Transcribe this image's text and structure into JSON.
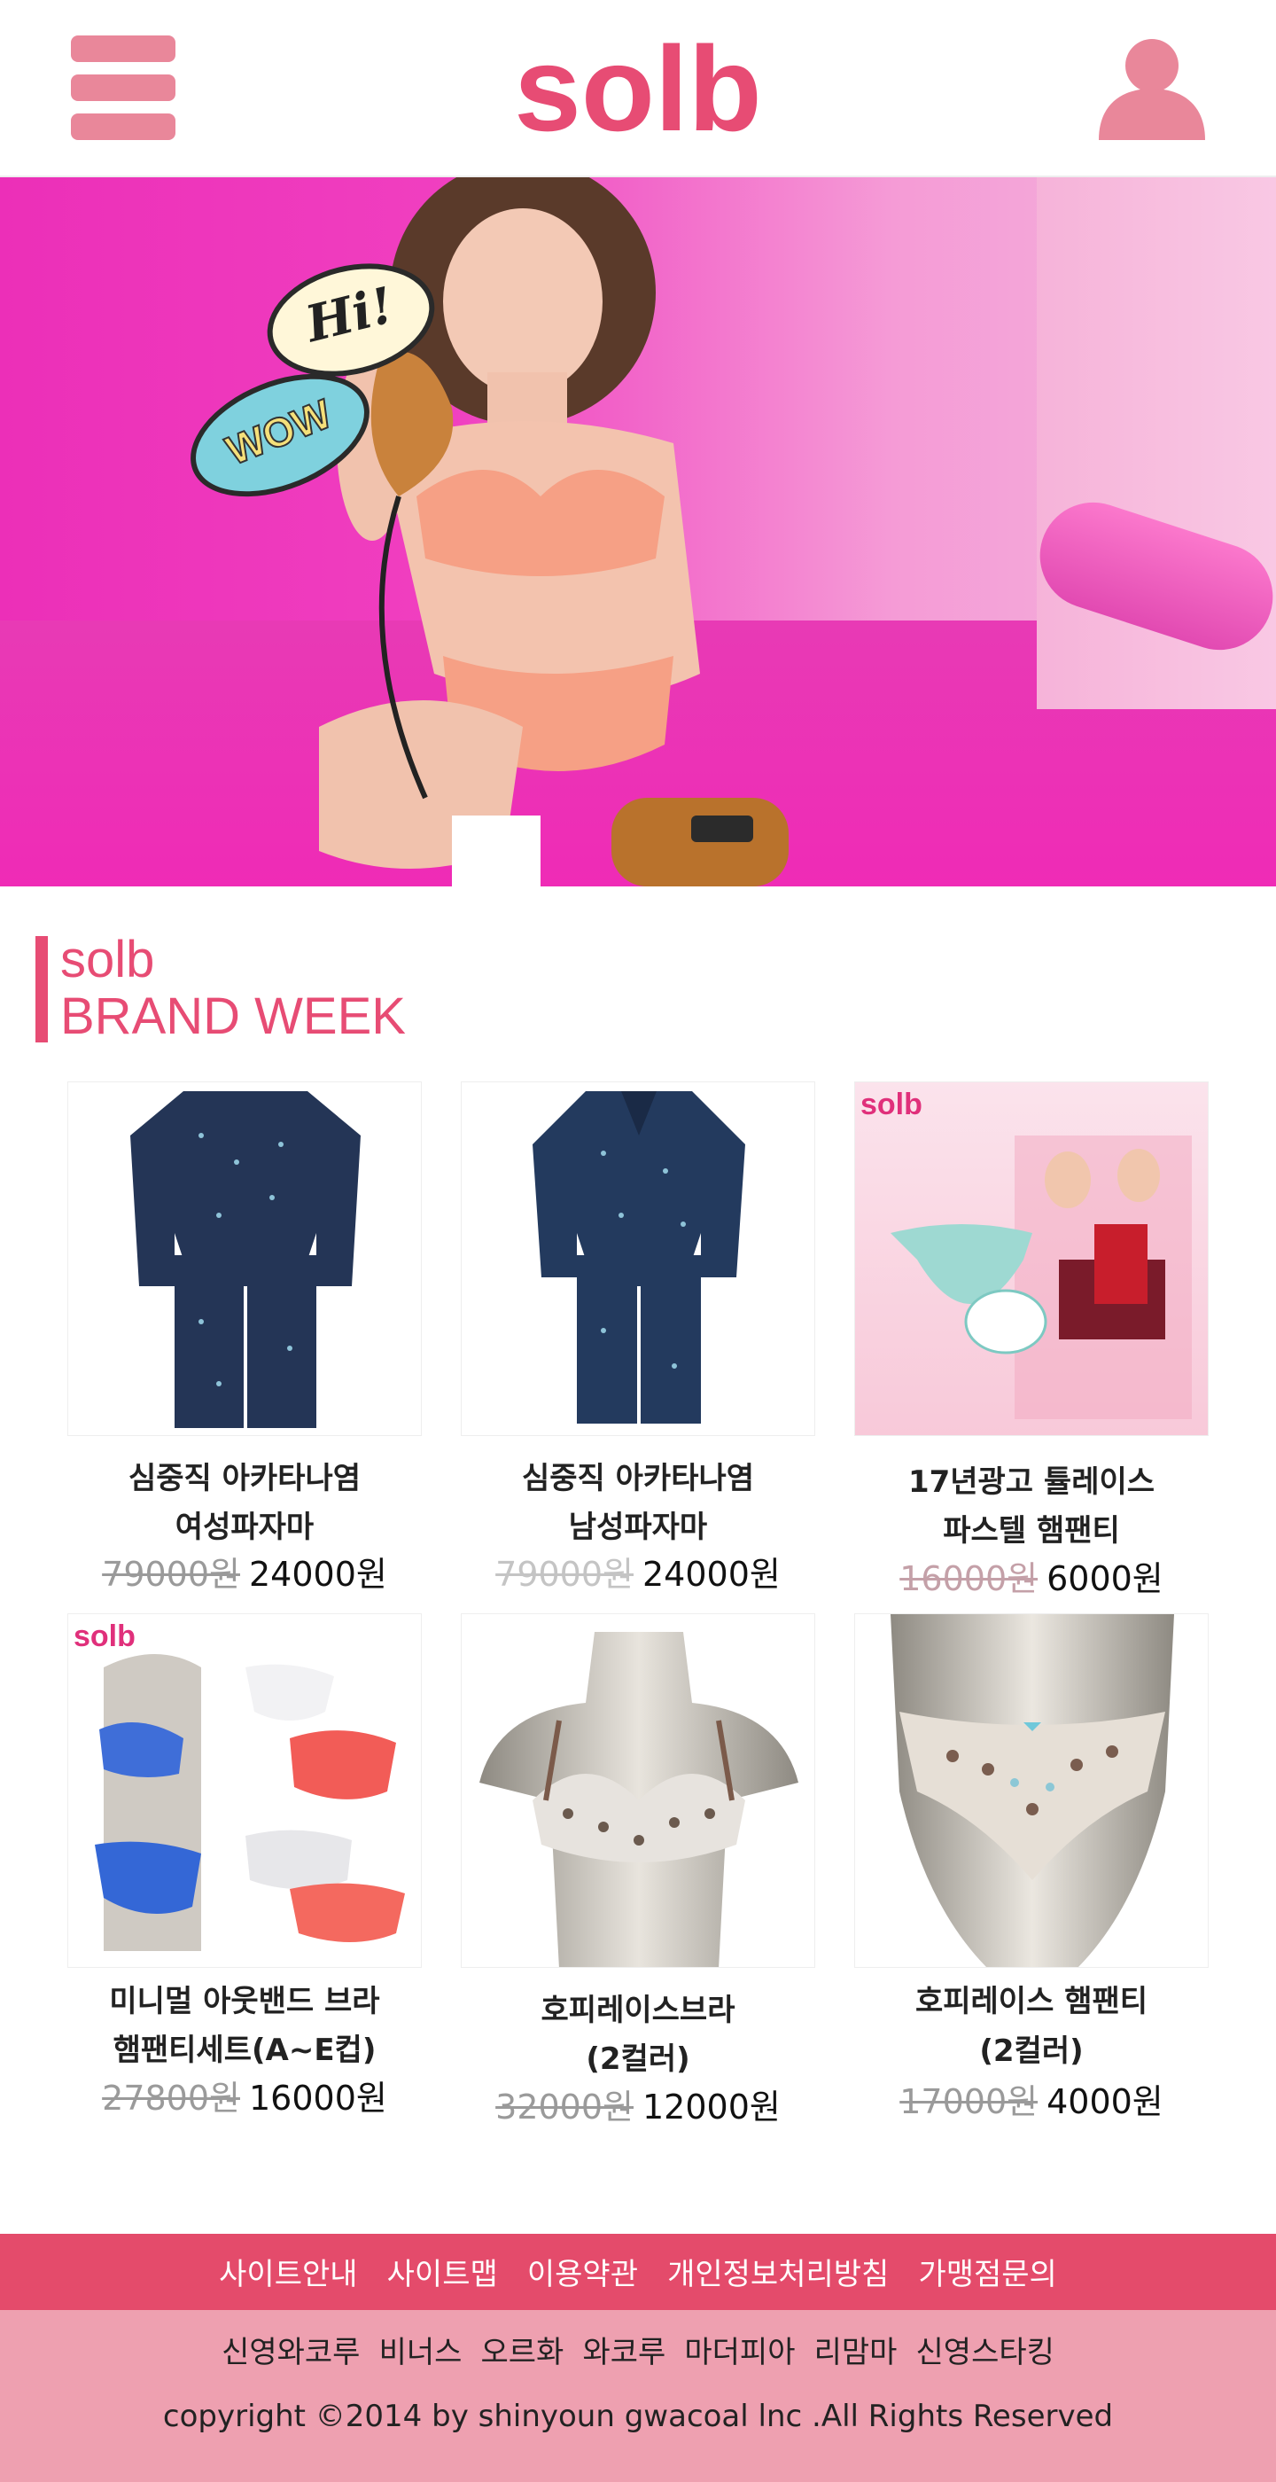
{
  "header": {
    "logo_text": "solb",
    "menu_icon": "hamburger-menu-icon",
    "user_icon": "user-account-icon",
    "accent_color": "#e74c74"
  },
  "hero": {
    "bubble_hi": "Hi!",
    "bubble_wow": "WOW"
  },
  "section": {
    "title_line1": "solb",
    "title_line2": "BRAND WEEK"
  },
  "products": [
    {
      "name_line1": "심중직 아카타나염",
      "name_line2": "여성파자마",
      "old_price": "79000원",
      "new_price": "24000원"
    },
    {
      "name_line1": "심중직 아카타나염",
      "name_line2": "남성파자마",
      "old_price": "79000원",
      "new_price": "24000원"
    },
    {
      "name_line1": "17년광고 튤레이스",
      "name_line2": "파스텔 햄팬티",
      "old_price": "16000원",
      "new_price": "6000원",
      "brand_tag": "solb"
    },
    {
      "name_line1": "미니멀 아웃밴드 브라",
      "name_line2": "햄팬티세트(A~E컵)",
      "old_price": "27800원",
      "new_price": "16000원",
      "brand_tag": "solb"
    },
    {
      "name_line1": "호피레이스브라",
      "name_line2": "(2컬러)",
      "old_price": "32000원",
      "new_price": "12000원"
    },
    {
      "name_line1": "호피레이스 햄팬티",
      "name_line2": "(2컬러)",
      "old_price": "17000원",
      "new_price": "4000원"
    }
  ],
  "footer": {
    "nav": [
      "사이트안내",
      "사이트맵",
      "이용약관",
      "개인정보처리방침",
      "가맹점문의"
    ],
    "brands": [
      "신영와코루",
      "비너스",
      "오르화",
      "와코루",
      "마더피아",
      "리맘마",
      "신영스타킹"
    ],
    "copyright": "copyright ©2014 by shinyoun gwacoal lnc .All Rights Reserved"
  }
}
